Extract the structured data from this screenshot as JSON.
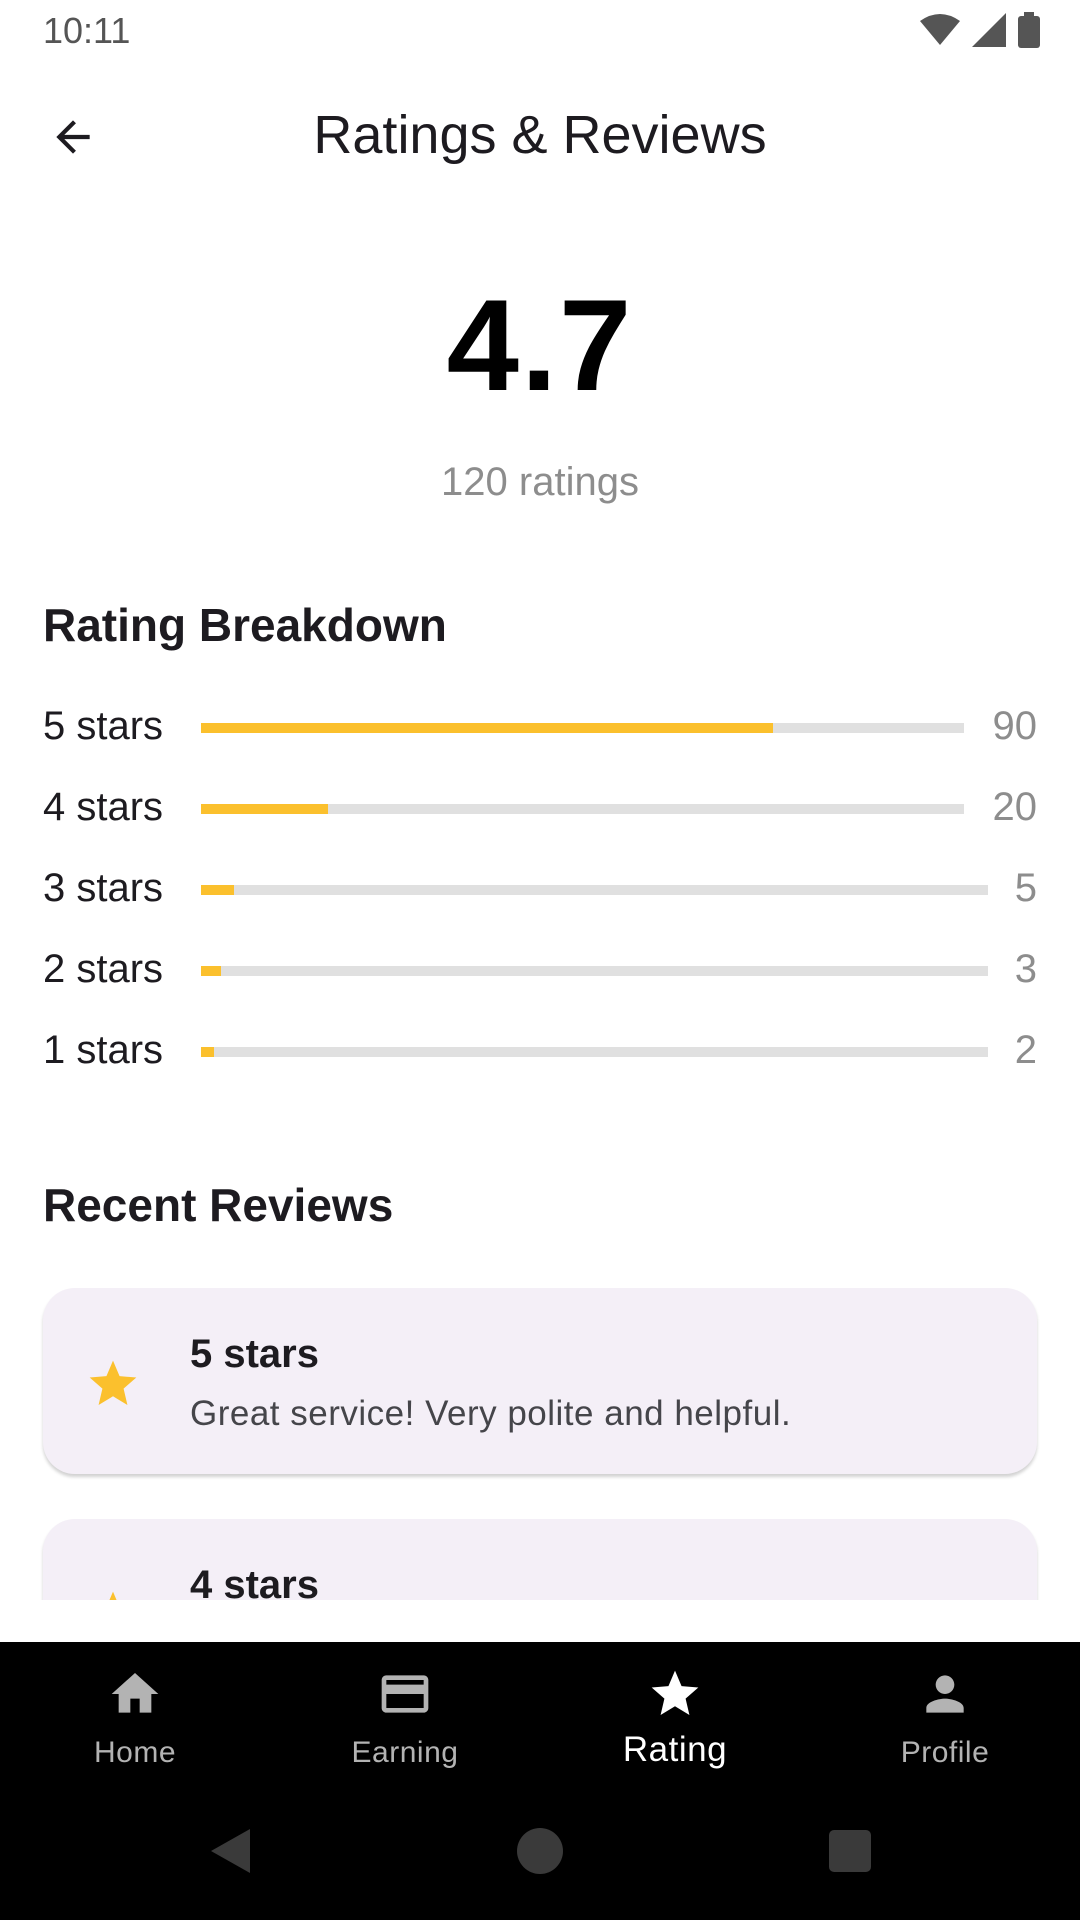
{
  "status_bar": {
    "time": "10:11"
  },
  "app_bar": {
    "title": "Ratings & Reviews"
  },
  "summary": {
    "average": "4.7",
    "ratings_count": "120 ratings"
  },
  "breakdown": {
    "title": "Rating Breakdown",
    "total": 120,
    "rows": [
      {
        "label": "5 stars",
        "count": "90",
        "fraction": 0.75
      },
      {
        "label": "4 stars",
        "count": "20",
        "fraction": 0.1667
      },
      {
        "label": "3 stars",
        "count": "5",
        "fraction": 0.0417
      },
      {
        "label": "2 stars",
        "count": "3",
        "fraction": 0.025
      },
      {
        "label": "1 stars",
        "count": "2",
        "fraction": 0.0167
      }
    ]
  },
  "reviews": {
    "title": "Recent Reviews",
    "items": [
      {
        "title": "5 stars",
        "text": "Great service! Very polite and helpful."
      },
      {
        "title": "4 stars",
        "text": ""
      }
    ]
  },
  "bottom_nav": {
    "items": [
      {
        "label": "Home",
        "icon": "home-icon",
        "active": false
      },
      {
        "label": "Earning",
        "icon": "card-icon",
        "active": false
      },
      {
        "label": "Rating",
        "icon": "star-icon",
        "active": true
      },
      {
        "label": "Profile",
        "icon": "person-icon",
        "active": false
      }
    ]
  },
  "colors": {
    "accent": "#fbc02d",
    "track": "#e0e0e0",
    "card_bg": "#f4eff7",
    "nav_bg": "#000000",
    "muted_text": "#8d8d8d"
  }
}
